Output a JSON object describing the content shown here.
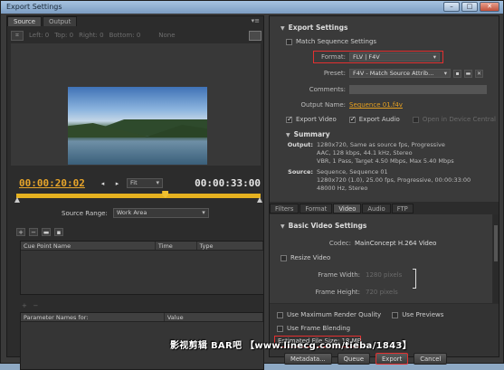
{
  "window": {
    "title": "Export Settings"
  },
  "left_tabs": [
    "Source",
    "Output"
  ],
  "crop": {
    "left": "Left: 0",
    "top": "Top: 0",
    "right": "Right: 0",
    "bottom": "Bottom: 0",
    "preset": "None"
  },
  "timeline": {
    "current": "00:00:20:02",
    "duration": "00:00:33:00",
    "fit": "Fit",
    "playhead_fraction": 0.61
  },
  "source_range": {
    "label": "Source Range:",
    "value": "Work Area"
  },
  "cue_table": {
    "columns": [
      "Cue Point Name",
      "Time",
      "Type"
    ]
  },
  "param_table": {
    "columns": [
      "Parameter Names for:",
      "Value"
    ]
  },
  "export_settings": {
    "heading": "Export Settings",
    "match_sequence": "Match Sequence Settings",
    "format_label": "Format:",
    "format_value": "FLV | F4V",
    "preset_label": "Preset:",
    "preset_value": "F4V - Match Source Attrib...",
    "comments_label": "Comments:",
    "output_name_label": "Output Name:",
    "output_name_value": "Sequence 01.f4v",
    "export_video": "Export Video",
    "export_audio": "Export Audio",
    "open_device": "Open in Device Central"
  },
  "summary": {
    "heading": "Summary",
    "output_label": "Output:",
    "output_lines": [
      "1280x720, Same as source fps, Progressive",
      "AAC, 128 kbps, 44.1 kHz, Stereo",
      "VBR, 1 Pass, Target 4.50 Mbps, Max 5.40 Mbps"
    ],
    "source_label": "Source:",
    "source_lines": [
      "Sequence, Sequence 01",
      "1280x720 (1.0), 25.00 fps, Progressive, 00:00:33:00",
      "48000 Hz, Stereo"
    ]
  },
  "right_tabs": [
    "Filters",
    "Format",
    "Video",
    "Audio",
    "FTP"
  ],
  "video": {
    "heading": "Basic Video Settings",
    "codec_label": "Codec:",
    "codec_value": "MainConcept H.264 Video",
    "resize": "Resize Video",
    "frame_width_label": "Frame Width:",
    "frame_width_value": "1280 pixels",
    "frame_height_label": "Frame Height:",
    "frame_height_value": "720 pixels"
  },
  "options": {
    "max_render": "Use Maximum Render Quality",
    "previews": "Use Previews",
    "frame_blending": "Use Frame Blending",
    "file_size": "Estimated File Size: 18 MB"
  },
  "buttons": [
    "Metadata...",
    "Queue",
    "Export",
    "Cancel"
  ],
  "watermark": "影视剪辑 BAR吧 【www.linecg.com/tieba/1843】"
}
